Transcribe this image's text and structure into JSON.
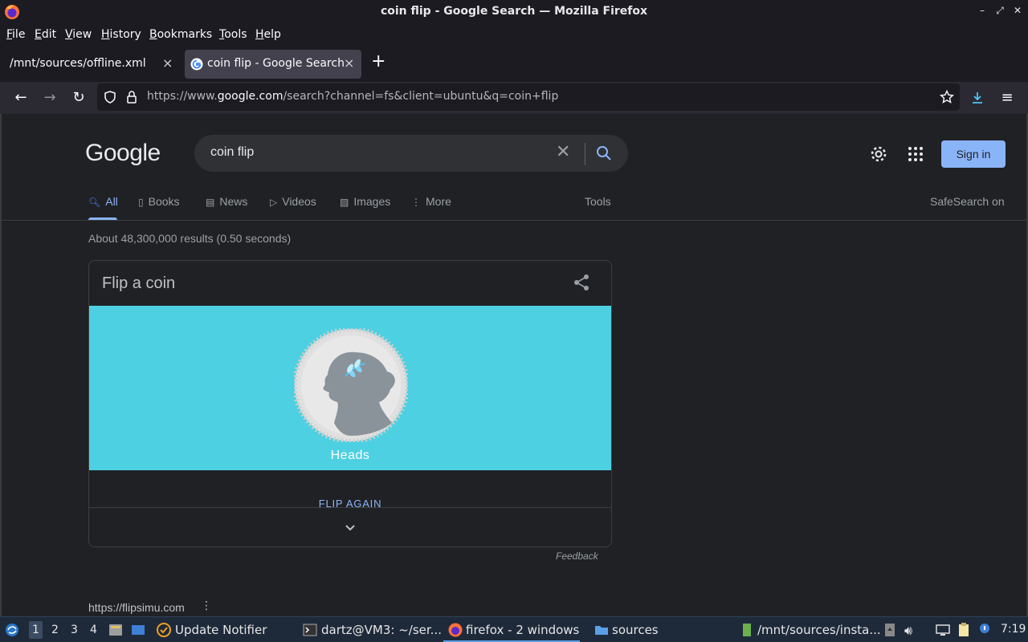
{
  "window": {
    "title": "coin flip - Google Search — Mozilla Firefox",
    "controls": [
      "–",
      "⤢",
      "✕"
    ]
  },
  "menu": [
    "File",
    "Edit",
    "View",
    "History",
    "Bookmarks",
    "Tools",
    "Help"
  ],
  "tabs": [
    {
      "label": "/mnt/sources/offline.xml",
      "active": false
    },
    {
      "label": "coin flip - Google Search",
      "active": true
    }
  ],
  "url": {
    "prefix": "https://www.",
    "host": "google.com",
    "path": "/search?channel=fs&client=ubuntu&q=coin+flip"
  },
  "google": {
    "logo": "Google",
    "query": "coin flip",
    "signin": "Sign in",
    "search_tabs": [
      {
        "label": "All",
        "icon": "search-icon",
        "active": true
      },
      {
        "label": "Books",
        "icon": "book-icon"
      },
      {
        "label": "News",
        "icon": "news-icon"
      },
      {
        "label": "Videos",
        "icon": "play-icon"
      },
      {
        "label": "Images",
        "icon": "image-icon"
      },
      {
        "label": "More",
        "icon": "kebab-icon"
      }
    ],
    "tools": "Tools",
    "safesearch": "SafeSearch on",
    "stats": "About 48,300,000 results (0.50 seconds)"
  },
  "coin_card": {
    "title": "Flip a coin",
    "result": "Heads",
    "flip_again": "FLIP AGAIN",
    "feedback": "Feedback",
    "coin_bg": "#4dd0e1"
  },
  "result": {
    "url": "https://flipsimu.com",
    "menu": "⋮"
  },
  "taskbar": {
    "workspaces": [
      "1",
      "2",
      "3",
      "4"
    ],
    "items": [
      {
        "label": "Update Notifier"
      },
      {
        "label": "dartz@VM3: ~/ser..."
      },
      {
        "label": "firefox - 2 windows",
        "active": true
      },
      {
        "label": "sources"
      },
      {
        "label": "/mnt/sources/insta..."
      }
    ],
    "clock": "7:19"
  }
}
